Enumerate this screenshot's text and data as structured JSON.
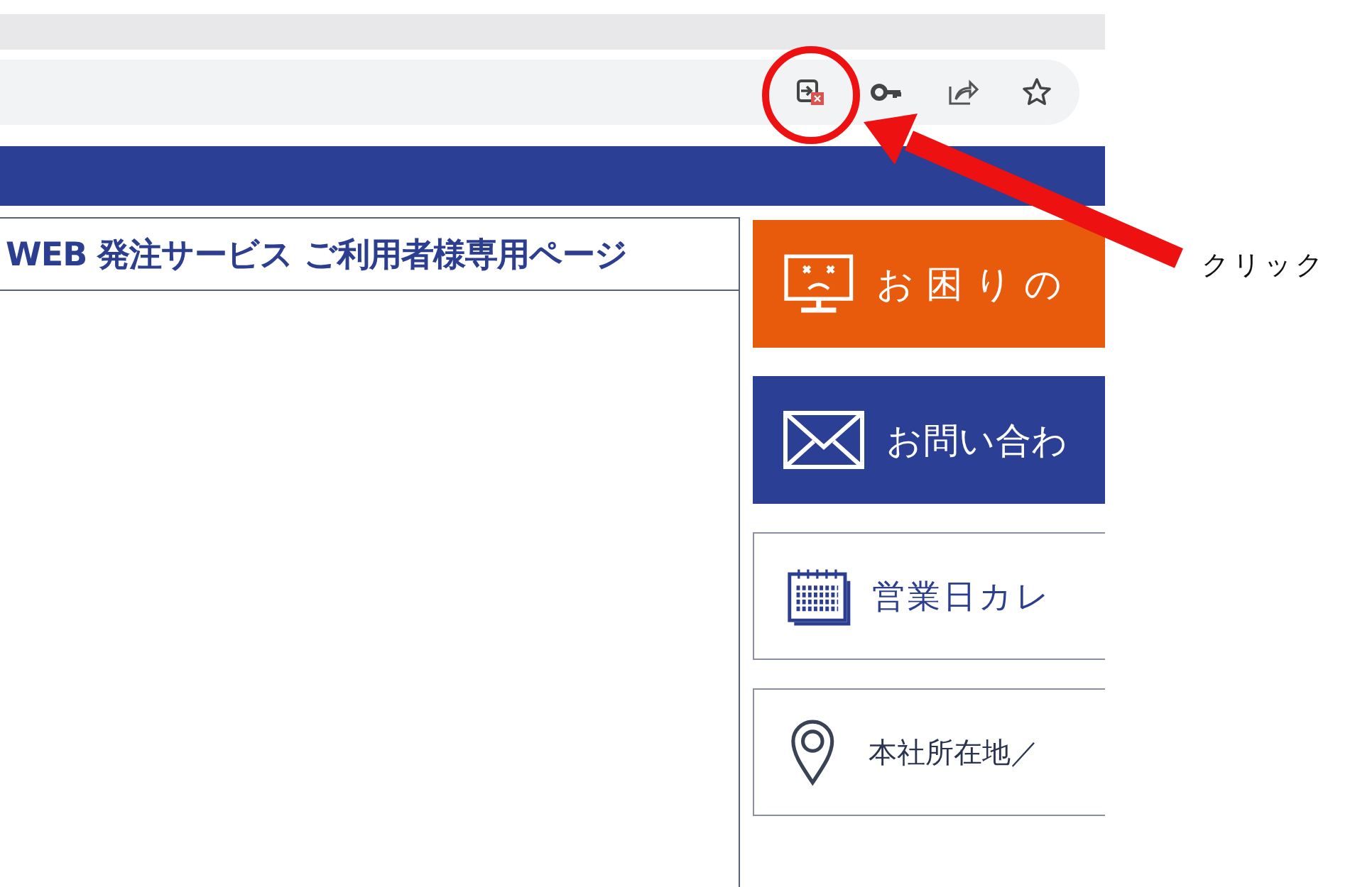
{
  "browser": {
    "toolbar_icons": [
      {
        "kind": "popup"
      },
      {
        "kind": "key"
      },
      {
        "kind": "share"
      },
      {
        "kind": "star"
      }
    ]
  },
  "page": {
    "title": "WEB 発注サービス ご利用者様専用ページ",
    "side_buttons": [
      {
        "kind": "trouble",
        "label": "お困りの"
      },
      {
        "kind": "contact",
        "label": "お問い合わ"
      },
      {
        "kind": "calendar",
        "label": "営業日カレ"
      },
      {
        "kind": "location",
        "label": "本社所在地／"
      }
    ]
  },
  "annotation": {
    "label": "クリック"
  }
}
